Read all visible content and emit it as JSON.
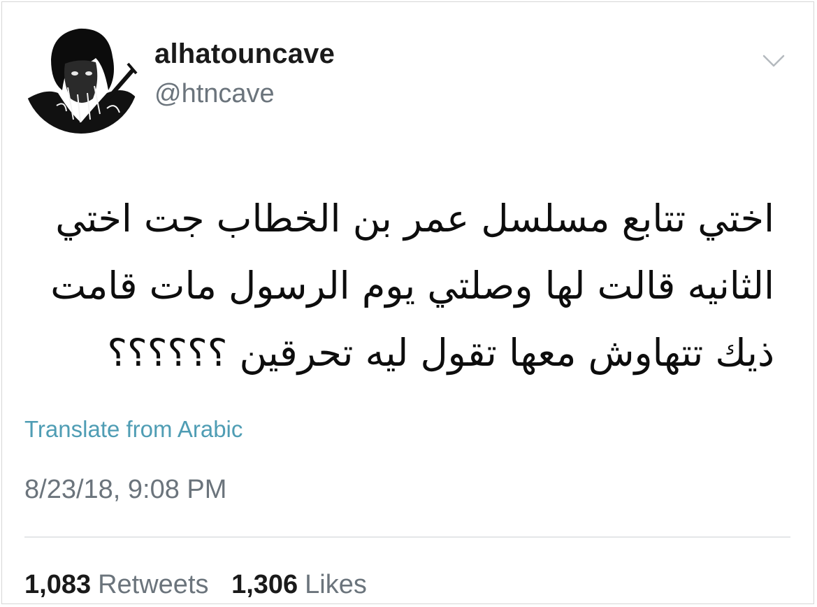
{
  "user": {
    "display_name": "alhatouncave",
    "handle": "@htncave"
  },
  "menu": {
    "icon": "chevron-down-icon"
  },
  "tweet": {
    "lines": [
      "اختي تتابع مسلسل عمر بن الخطاب جت اختي",
      "الثانيه قالت لها وصلتي يوم الرسول مات قامت",
      "ذيك تتهاوش معها تقول ليه تحرقين ؟؟؟؟؟؟"
    ],
    "translate_label": "Translate from Arabic",
    "timestamp": "8/23/18, 9:08 PM"
  },
  "stats": {
    "retweets_count": "1,083",
    "retweets_label": "Retweets",
    "likes_count": "1,306",
    "likes_label": "Likes"
  },
  "colors": {
    "link": "#4f9db4",
    "secondary_text": "#6b747c",
    "primary_text": "#14171a"
  }
}
